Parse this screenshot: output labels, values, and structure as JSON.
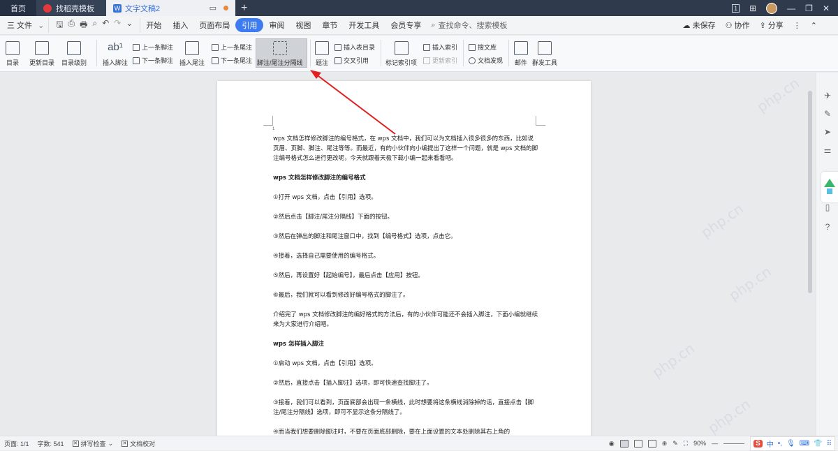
{
  "tabs": {
    "home": "首页",
    "template": "找稻壳模板",
    "doc": "文字文稿2",
    "new": "+"
  },
  "titlebar_right": {
    "pages": "1",
    "grid": "⊞",
    "minimize": "—",
    "restore": "❐",
    "close": "✕"
  },
  "menu": {
    "file": "三 文件",
    "items": [
      "开始",
      "插入",
      "页面布局",
      "引用",
      "审阅",
      "视图",
      "章节",
      "开发工具",
      "会员专享"
    ],
    "selected_index": 3,
    "search": "查找命令、搜索模板",
    "unsaved": "未保存",
    "collab": "协作",
    "share": "分享"
  },
  "ribbon": {
    "toc": "目录",
    "update_toc": "更新目录",
    "toc_level": "目录级别",
    "insert_footnote": "插入脚注",
    "prev_footnote": "上一条脚注",
    "next_footnote": "下一条脚注",
    "insert_endnote": "插入尾注",
    "prev_endnote": "上一条尾注",
    "next_endnote": "下一条尾注",
    "separator_line": "脚注/尾注分隔线",
    "caption": "题注",
    "insert_table_of_figures": "插入表目录",
    "cross_reference": "交叉引用",
    "mark_index": "标记索引项",
    "insert_index": "插入索引",
    "update_index": "更新索引",
    "search_library": "搜文库",
    "doc_discovery": "文档发现",
    "mail": "邮件",
    "group_tools": "群发工具"
  },
  "document": {
    "page_marker": "1",
    "intro": "wps 文档怎样修改脚注的编号格式，在 wps 文档中，我们可以为文档插入很多很多的东西，比如说页眉、页脚、脚注、尾注等等。而最近，有的小伙伴向小编提出了这样一个问题，就是 wps 文档的脚注编号格式怎么进行更改呢，今天就跟着天极下载小编一起来看看吧。",
    "heading1": "wps 文档怎样修改脚注的编号格式",
    "steps1": [
      "①打开 wps 文档，点击【引用】选项。",
      "②然后点击【脚注/尾注分隔线】下面的按钮。",
      "③然后在弹出的脚注和尾注窗口中，找到【编号格式】选项，点击它。",
      "④接着，选择自己需要使用的编号格式。",
      "⑤然后，再设置好【起始编号】，最后点击【应用】按钮。",
      "⑥最后，我们就可以看到修改好编号格式的脚注了。"
    ],
    "transition": "介绍完了 wps 文档修改脚注的编好格式的方法后，有的小伙伴可能还不会插入脚注，下面小编就继续来为大家进行介绍吧。",
    "heading2": "wps 怎样插入脚注",
    "steps2": [
      "①启动 wps 文档，点击【引用】选项。",
      "②然后，直接点击【插入脚注】选项，即可快速查找脚注了。",
      "③接着，我们可以看到，页面底部会出现一条横线，此时想要将这条横线消除掉的话，直接点击【脚注/尾注分隔线】选项，即可不显示这条分隔线了。",
      "④而当我们想要删除脚注时，不要在页面底部删除，要在上面设置的文本处删除其右上角的"
    ],
    "watermark": "php.cn"
  },
  "status": {
    "page": "页面: 1/1",
    "words": "字数: 541",
    "spellcheck": "拼写检查",
    "proofread": "文档校对",
    "zoom": "90%",
    "ime_logo": "S",
    "ime_lang": "中"
  },
  "colors": {
    "accent": "#3c7cf0",
    "arrow": "#e02020",
    "tabbar": "#2f3a4c"
  }
}
